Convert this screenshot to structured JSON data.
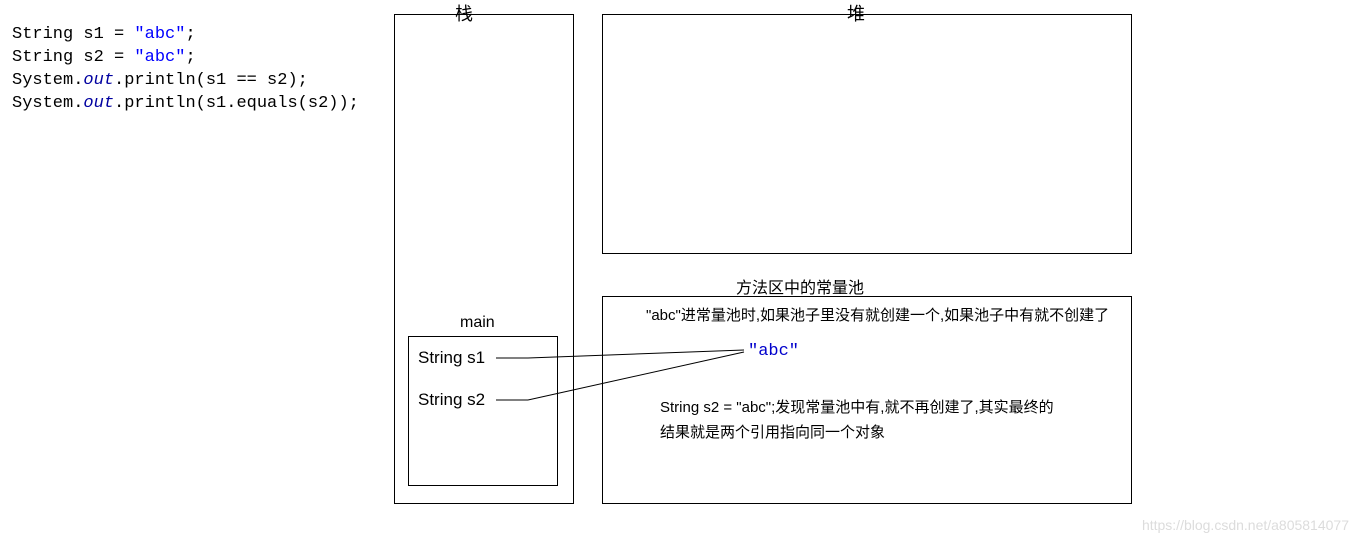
{
  "code": {
    "line1_pre": "String s1 = ",
    "line1_str": "\"abc\"",
    "line1_post": ";",
    "line2_pre": "String s2 = ",
    "line2_str": "\"abc\"",
    "line2_post": ";",
    "line3_pre": "System.",
    "line3_out": "out",
    "line3_post": ".println(s1 == s2);",
    "line4_pre": "System.",
    "line4_out": "out",
    "line4_post": ".println(s1.equals(s2));"
  },
  "labels": {
    "stack": "栈",
    "heap": "堆",
    "main": "main",
    "s1": "String s1",
    "s2": "String s2",
    "constpool": "方法区中的常量池"
  },
  "pool": {
    "note1": "\"abc\"进常量池时,如果池子里没有就创建一个,如果池子中有就不创建了",
    "abc": "\"abc\"",
    "note2": "String s2 = \"abc\";发现常量池中有,就不再创建了,其实最终的结果就是两个引用指向同一个对象"
  },
  "watermark": "https://blog.csdn.net/a805814077"
}
